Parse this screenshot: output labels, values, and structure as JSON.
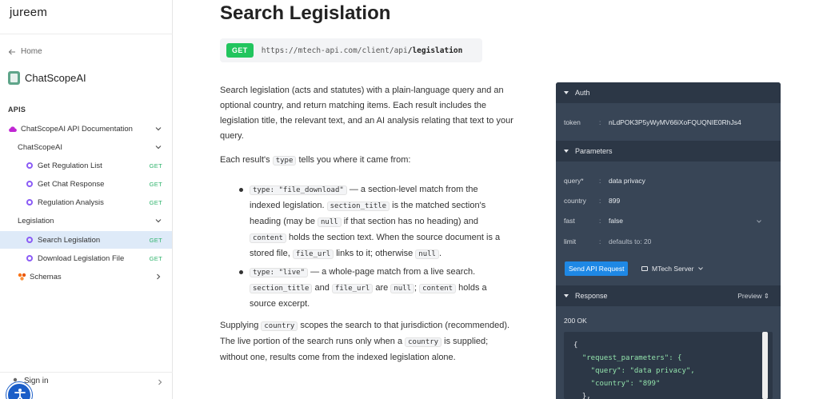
{
  "sidebar": {
    "brand": "jureem",
    "home_label": "Home",
    "product_name": "ChatScopeAI",
    "section_label": "APIS",
    "tree": [
      {
        "label": "ChatScopeAI API Documentation",
        "kind": "group",
        "icon": "cloud-icon"
      },
      {
        "label": "ChatScopeAI",
        "kind": "folder"
      },
      {
        "label": "Get Regulation List",
        "kind": "endpoint",
        "method": "GET"
      },
      {
        "label": "Get Chat Response",
        "kind": "endpoint",
        "method": "GET"
      },
      {
        "label": "Regulation Analysis",
        "kind": "endpoint",
        "method": "GET"
      },
      {
        "label": "Legislation",
        "kind": "folder"
      },
      {
        "label": "Search Legislation",
        "kind": "endpoint",
        "method": "GET",
        "active": true
      },
      {
        "label": "Download Legislation File",
        "kind": "endpoint",
        "method": "GET"
      },
      {
        "label": "Schemas",
        "kind": "group",
        "icon": "schema-icon"
      }
    ],
    "sign_in_label": "Sign in"
  },
  "main": {
    "title": "Search Legislation",
    "method": "GET",
    "url_base": "https://mtech-api.com/client/api",
    "url_path": "/legislation",
    "intro": "Search legislation (acts and statutes) with a plain-language query and an optional country, and return matching items. Each result includes the legislation title, the relevant text, and an AI analysis relating that text to your query.",
    "type_line": {
      "before": "Each result's",
      "code": "type",
      "after": "tells you where it came from:"
    },
    "bullet1": {
      "code_type": "type: \"file_download\"",
      "t1": "— a section-level match from the indexed legislation.",
      "code_section": "section_title",
      "t2": "is the matched section's heading (may be",
      "code_null": "null",
      "t3": "if that section has no heading) and",
      "code_content": "content",
      "t4": "holds the section text. When the source document is a stored file,",
      "code_file": "file_url",
      "t5": "links to it; otherwise",
      "code_null2": "null",
      "t6": "."
    },
    "bullet2": {
      "code_type": "type: \"live\"",
      "t1": "— a whole-page match from a live search.",
      "code_section": "section_title",
      "t2": "and",
      "code_file": "file_url",
      "t3": "are",
      "code_null": "null",
      "t4": ";",
      "code_content": "content",
      "t5": "holds a source excerpt."
    },
    "supply": {
      "before": "Supplying",
      "code1": "country",
      "mid": "scopes the search to that jurisdiction (recommended). The live portion of the search runs only when a",
      "code2": "country",
      "after": "is supplied; without one, results come from the indexed legislation alone."
    }
  },
  "console": {
    "auth_label": "Auth",
    "token_key": "token",
    "token_value": "nLdPOK3P5yWyMV66iXoFQUQNIE0RhJs4",
    "params_label": "Parameters",
    "params": [
      {
        "key": "query*",
        "value": "data privacy",
        "muted": false
      },
      {
        "key": "country",
        "value": "899",
        "muted": false
      },
      {
        "key": "fast",
        "value": "false",
        "muted": false
      },
      {
        "key": "limit",
        "value": "defaults to: 20",
        "muted": true
      }
    ],
    "send_label": "Send API Request",
    "server_label": "MTech Server",
    "response_label": "Response",
    "preview_label": "Preview",
    "status": "200 OK",
    "json_lines": [
      "{",
      "  \"request_parameters\": {",
      "    \"query\": \"data privacy\",",
      "    \"country\": \"899\"",
      "  },"
    ]
  }
}
